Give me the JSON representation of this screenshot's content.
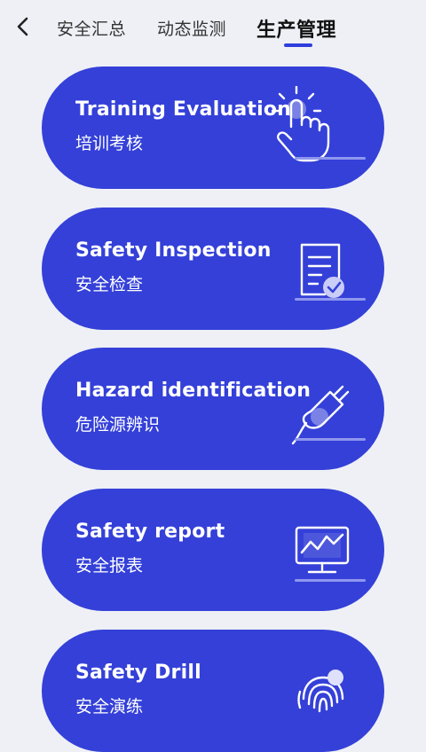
{
  "header": {
    "tabs": [
      {
        "label": "安全汇总",
        "active": false
      },
      {
        "label": "动态监测",
        "active": false
      },
      {
        "label": "生产管理",
        "active": true
      }
    ]
  },
  "cards": [
    {
      "title": "Training Evaluation",
      "subtitle": "培训考核",
      "icon": "touch-hand-icon"
    },
    {
      "title": "Safety Inspection",
      "subtitle": "安全检查",
      "icon": "checklist-icon"
    },
    {
      "title": "Hazard identification",
      "subtitle": "危险源辨识",
      "icon": "plug-icon"
    },
    {
      "title": "Safety report",
      "subtitle": "安全报表",
      "icon": "monitor-chart-icon"
    },
    {
      "title": "Safety Drill",
      "subtitle": "安全演练",
      "icon": "fingerprint-icon"
    }
  ],
  "colors": {
    "accent": "#3440d8",
    "background": "#eef0f5"
  }
}
